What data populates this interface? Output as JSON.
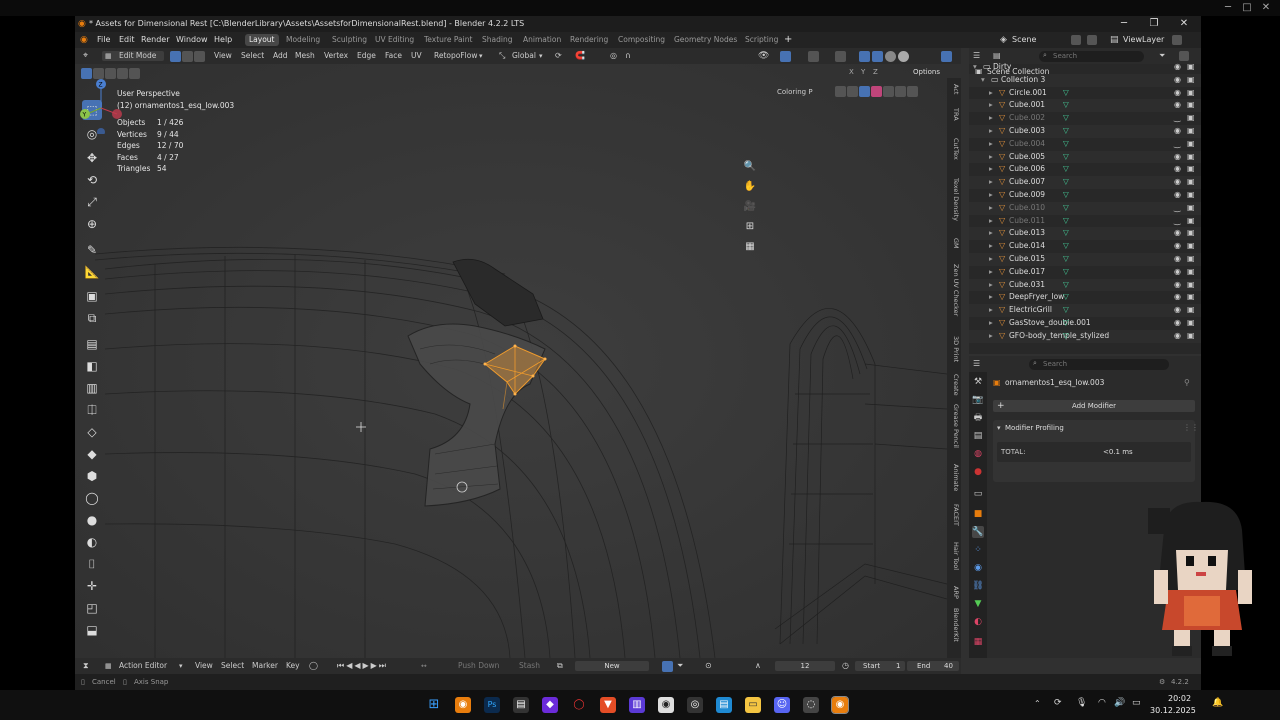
{
  "window": {
    "title": "* Assets for Dimensional Rest [C:\\BlenderLibrary\\Assets\\AssetsforDimensionalRest.blend] - Blender 4.2.2 LTS"
  },
  "menu": [
    "File",
    "Edit",
    "Render",
    "Window",
    "Help"
  ],
  "workspaces": [
    "Layout",
    "Modeling",
    "Sculpting",
    "UV Editing",
    "Texture Paint",
    "Shading",
    "Animation",
    "Rendering",
    "Compositing",
    "Geometry Nodes",
    "Scripting"
  ],
  "active_workspace": "Layout",
  "scene": {
    "scene_label": "Scene",
    "view_layer_label": "ViewLayer"
  },
  "viewport_header": {
    "mode": "Edit Mode",
    "menus": [
      "View",
      "Select",
      "Add",
      "Mesh",
      "Vertex",
      "Edge",
      "Face",
      "UV"
    ],
    "addon": "RetopoFlow",
    "transform": "Global",
    "options": "Options",
    "axes": [
      "X",
      "Y",
      "Z"
    ],
    "coloring": "Coloring P"
  },
  "overlay": {
    "perspective": "User Perspective",
    "object": "(12) ornamentos1_esq_low.003",
    "stats": [
      {
        "label": "Objects",
        "value": "1 / 426"
      },
      {
        "label": "Vertices",
        "value": "9 / 44"
      },
      {
        "label": "Edges",
        "value": "12 / 70"
      },
      {
        "label": "Faces",
        "value": "4 / 27"
      },
      {
        "label": "Triangles",
        "value": "54"
      }
    ]
  },
  "side_tabs": [
    "Act",
    "TRA",
    "CutTex",
    "Texel Density",
    "GM",
    "Zen UV Checker",
    "3D Print",
    "Create",
    "Grease Pencil",
    "Animate",
    "FACEIT",
    "Hair Tool",
    "ARP",
    "BlenderKit"
  ],
  "outliner": {
    "search_placeholder": "Search",
    "scene_collection": "Scene Collection",
    "items": [
      {
        "name": "Dirty",
        "dim": false
      },
      {
        "name": "Collection 3",
        "dim": false
      },
      {
        "name": "Circle.001",
        "dim": false
      },
      {
        "name": "Cube.001",
        "dim": false
      },
      {
        "name": "Cube.002",
        "dim": true
      },
      {
        "name": "Cube.003",
        "dim": false
      },
      {
        "name": "Cube.004",
        "dim": true
      },
      {
        "name": "Cube.005",
        "dim": false
      },
      {
        "name": "Cube.006",
        "dim": false
      },
      {
        "name": "Cube.007",
        "dim": false
      },
      {
        "name": "Cube.009",
        "dim": false
      },
      {
        "name": "Cube.010",
        "dim": true
      },
      {
        "name": "Cube.011",
        "dim": true
      },
      {
        "name": "Cube.013",
        "dim": false
      },
      {
        "name": "Cube.014",
        "dim": false
      },
      {
        "name": "Cube.015",
        "dim": false
      },
      {
        "name": "Cube.017",
        "dim": false
      },
      {
        "name": "Cube.031",
        "dim": false
      },
      {
        "name": "DeepFryer_low",
        "dim": false
      },
      {
        "name": "ElectricGrill",
        "dim": false
      },
      {
        "name": "GasStove_double.001",
        "dim": false
      },
      {
        "name": "GFO-body_temple_stylized",
        "dim": false
      }
    ]
  },
  "properties": {
    "search_placeholder": "Search",
    "object_name": "ornamentos1_esq_low.003",
    "add_modifier": "Add Modifier",
    "panel_title": "Modifier Profiling",
    "total_label": "TOTAL:",
    "total_value": "<0.1 ms"
  },
  "timeline": {
    "editor": "Action Editor",
    "menus": [
      "View",
      "Select",
      "Marker",
      "Key"
    ],
    "push_down": "Push Down",
    "stash": "Stash",
    "new": "New",
    "current_frame": "12",
    "start_label": "Start",
    "start_value": "1",
    "end_label": "End",
    "end_value": "40"
  },
  "status_bar": {
    "cancel": "Cancel",
    "axis_snap": "Axis Snap",
    "version": "4.2.2"
  },
  "taskbar": {
    "time": "20:02",
    "date": "30.12.2025"
  },
  "colors": {
    "accent": "#4772b3",
    "selection": "#f09b2c",
    "bg": "#303030"
  }
}
